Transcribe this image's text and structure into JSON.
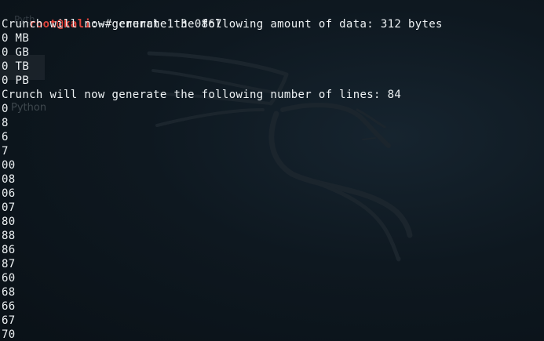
{
  "terminal": {
    "prompt": {
      "user_host": "root@kali",
      "path": ":~",
      "symbol": "# ",
      "command": "crunch 1 3 0867"
    },
    "output": [
      "Crunch will now generate the following amount of data: 312 bytes",
      "0 MB",
      "0 GB",
      "0 TB",
      "0 PB",
      "Crunch will now generate the following number of lines: 84",
      "0",
      "8",
      "6",
      "7",
      "00",
      "08",
      "06",
      "07",
      "80",
      "88",
      "86",
      "87",
      "60",
      "68",
      "66",
      "67",
      "70"
    ]
  },
  "desktop": {
    "icon_label": "Python",
    "icon_label_top": "Pyth"
  },
  "colors": {
    "background": "#0e1820",
    "text": "#eef2f4",
    "prompt_user": "#e0443c",
    "dragon": "#1c262e"
  }
}
